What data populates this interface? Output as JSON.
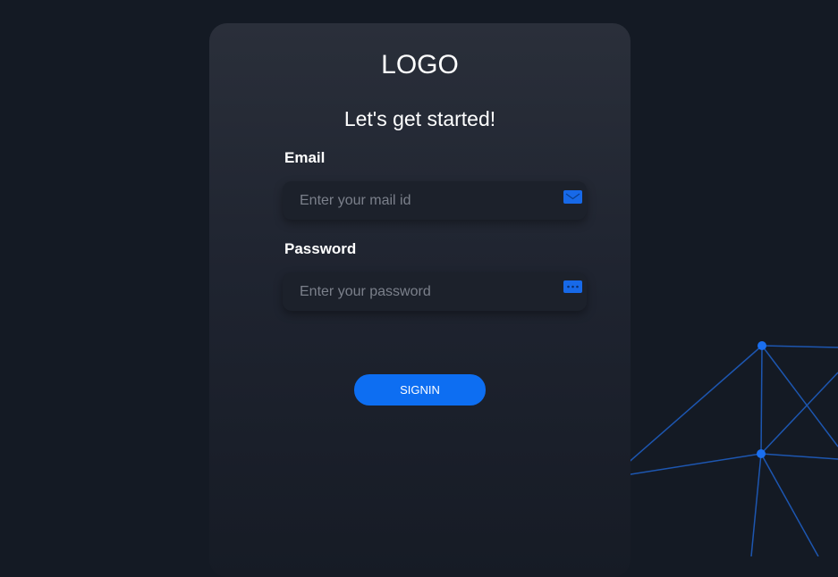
{
  "brand": {
    "logo_text": "LOGO"
  },
  "form": {
    "heading": "Let's get started!",
    "email": {
      "label": "Email",
      "placeholder": "Enter your mail id",
      "icon": "mail-icon"
    },
    "password": {
      "label": "Password",
      "placeholder": "Enter your password",
      "icon": "password-dots-icon"
    },
    "submit_label": "SIGNIN"
  },
  "colors": {
    "background": "#141a24",
    "card": "#262b36",
    "accent": "#0d6ef2",
    "network_line": "#1d56b0",
    "network_node": "#1a6ff0"
  }
}
